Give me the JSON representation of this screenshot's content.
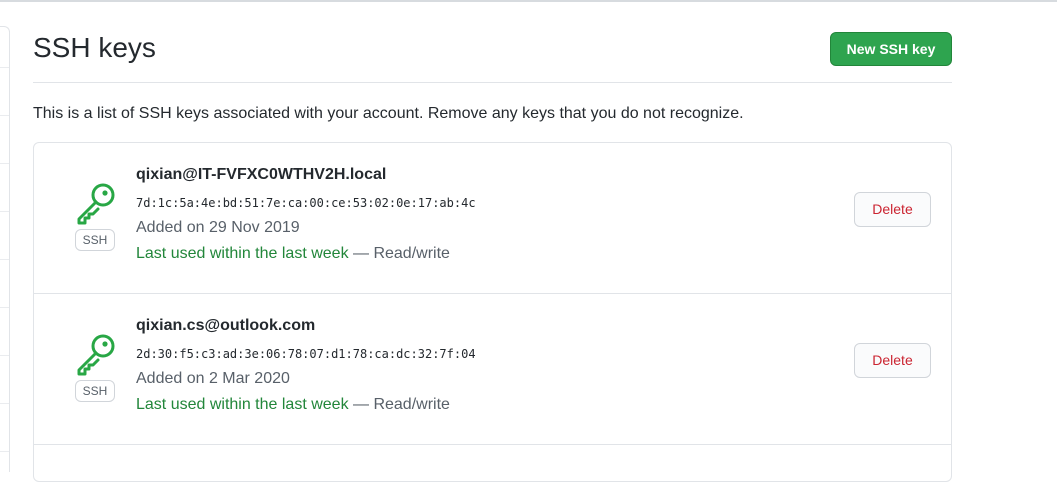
{
  "header": {
    "title": "SSH keys",
    "new_key_label": "New SSH key"
  },
  "intro_text": "This is a list of SSH keys associated with your account. Remove any keys that you do not recognize.",
  "keys": [
    {
      "title": "qixian@IT-FVFXC0WTHV2H.local",
      "fingerprint": "7d:1c:5a:4e:bd:51:7e:ca:00:ce:53:02:0e:17:ab:4c",
      "badge": "SSH",
      "added": "Added on 29 Nov 2019",
      "last_used": "Last used within the last week",
      "access": " — Read/write",
      "delete_label": "Delete",
      "icon": "key-icon"
    },
    {
      "title": "qixian.cs@outlook.com",
      "fingerprint": "2d:30:f5:c3:ad:3e:06:78:07:d1:78:ca:dc:32:7f:04",
      "badge": "SSH",
      "added": "Added on 2 Mar 2020",
      "last_used": "Last used within the last week",
      "access": " — Read/write",
      "delete_label": "Delete",
      "icon": "key-icon"
    }
  ],
  "colors": {
    "primary_button": "#2ea44f",
    "key_icon": "#28a745",
    "danger": "#cb2431",
    "success_text": "#22863a"
  }
}
